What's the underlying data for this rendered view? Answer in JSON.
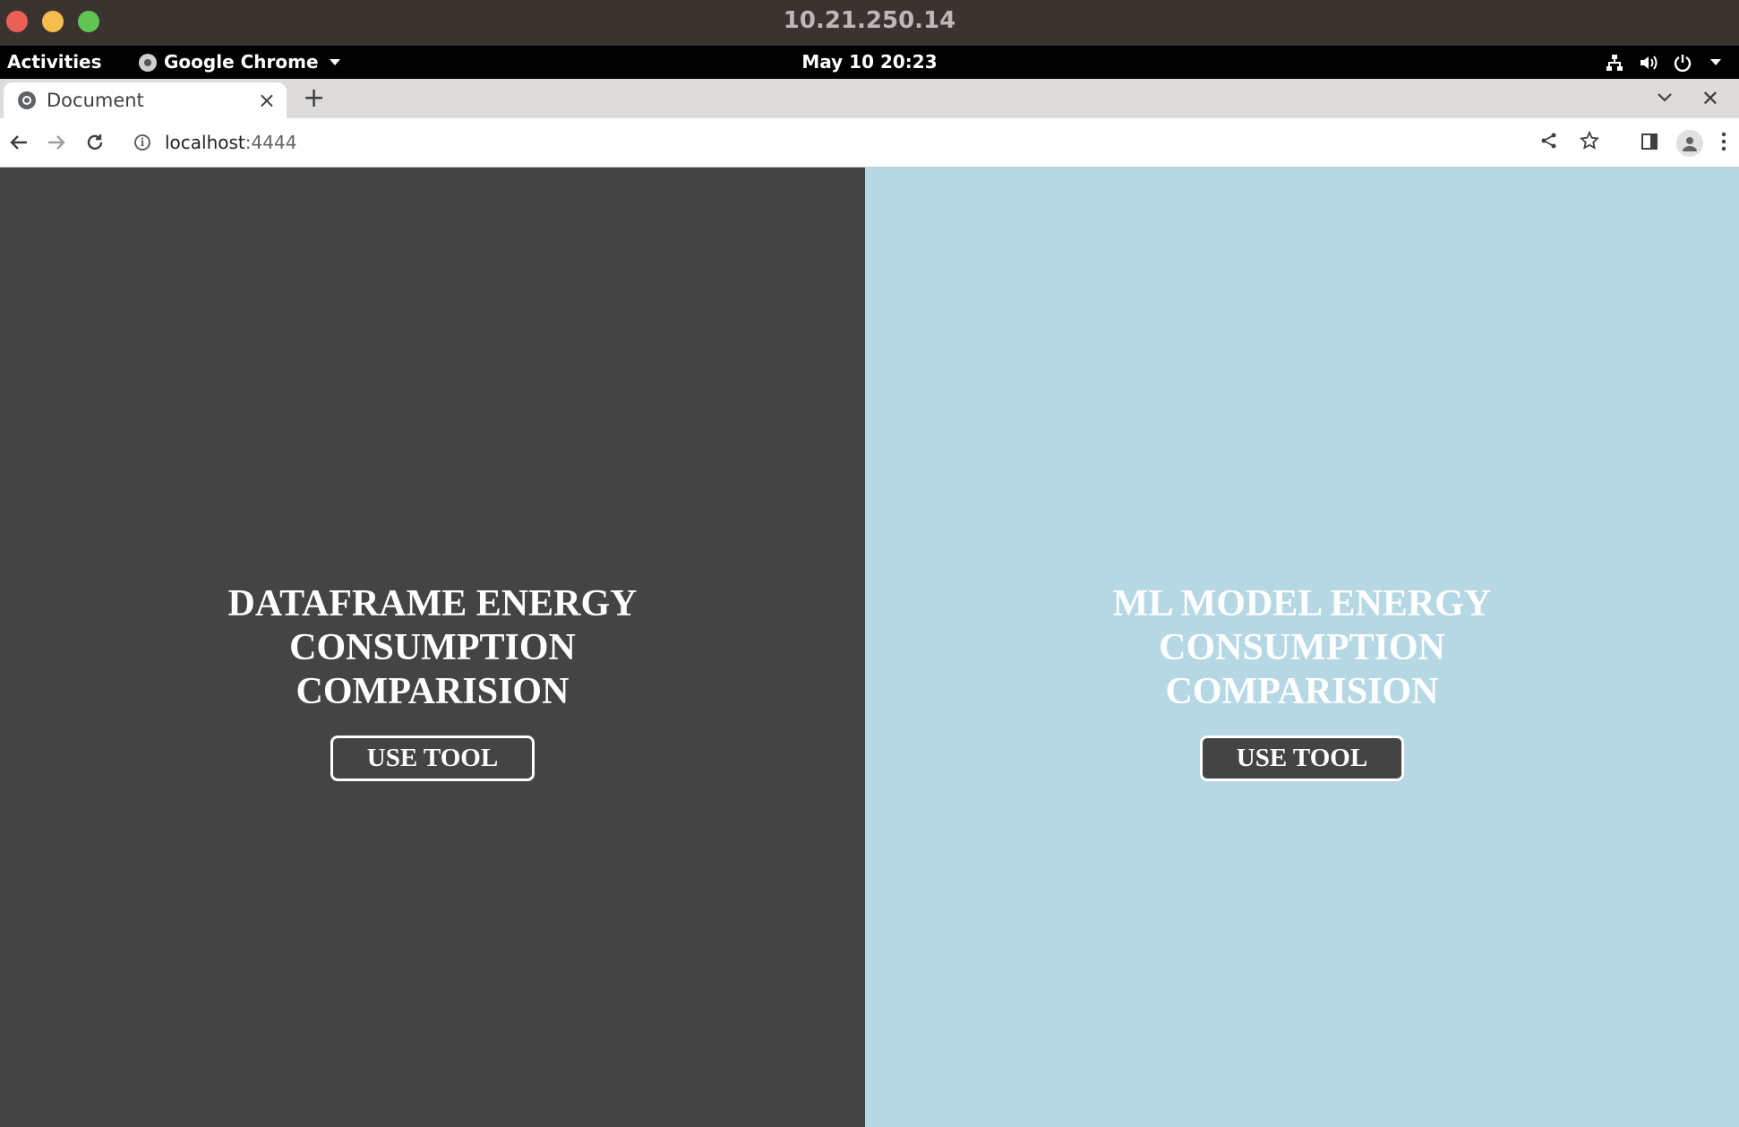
{
  "window": {
    "title": "10.21.250.14"
  },
  "gnome": {
    "activities": "Activities",
    "app_name": "Google Chrome",
    "clock": "May 10  20:23"
  },
  "browser": {
    "tab_title": "Document",
    "url_host": "localhost",
    "url_port": ":4444"
  },
  "page": {
    "left": {
      "heading": "DATAFRAME ENERGY CONSUMPTION COMPARISION",
      "button_label": "USE TOOL",
      "background": "#444444"
    },
    "right": {
      "heading": "ML MODEL ENERGY CONSUMPTION COMPARISION",
      "button_label": "USE TOOL",
      "background": "#b6d8e4"
    }
  },
  "icons": {
    "tray": [
      "network-icon",
      "volume-icon",
      "power-icon"
    ],
    "toolbar": [
      "back-arrow-icon",
      "forward-arrow-icon",
      "reload-icon",
      "share-icon",
      "bookmark-star-icon",
      "side-panel-icon",
      "profile-icon",
      "menu-kebab-icon"
    ]
  }
}
